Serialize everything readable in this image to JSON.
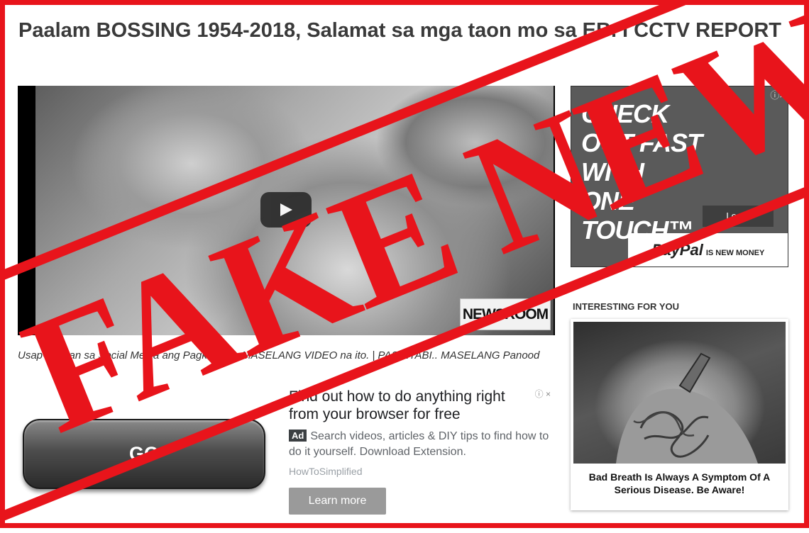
{
  "article": {
    "title": "Paalam BOSSING 1954-2018, Salamat sa mga taon mo sa EB. I CCTV REPORT",
    "caption": "Usap-usapan sa Social Media ang Pagkalat ng MASELANG VIDEO na ito. | PASINTABI.. MASELANG Panood"
  },
  "video": {
    "channel_logo": "NEWSROOM",
    "play_icon": "play-icon"
  },
  "go_button": {
    "label": "GO"
  },
  "text_ad": {
    "headline": "Find out how to do anything right from your browser for free",
    "badge": "Ad",
    "body": "Search videos, articles & DIY tips to find how to do it yourself. Download Extension.",
    "source": "HowToSimplified",
    "cta": "Learn more",
    "adchoices": "ⓘ ×"
  },
  "side_ad": {
    "headline": "CHECK OUT FAST WITH ONE TOUCH™",
    "cta": "Learn",
    "brand": "PayPal",
    "tagline": "IS NEW MONEY",
    "adchoices": "ⓘ×"
  },
  "recommendations": {
    "heading": "INTERESTING FOR YOU",
    "items": [
      {
        "title": "Bad Breath Is Always A Symptom Of A Serious Disease. Be Aware!"
      }
    ]
  },
  "stamp": {
    "text": "FAKE NEWS",
    "color": "#e8141b"
  },
  "colors": {
    "frame": "#e8141b",
    "title": "#3a3a3a"
  }
}
